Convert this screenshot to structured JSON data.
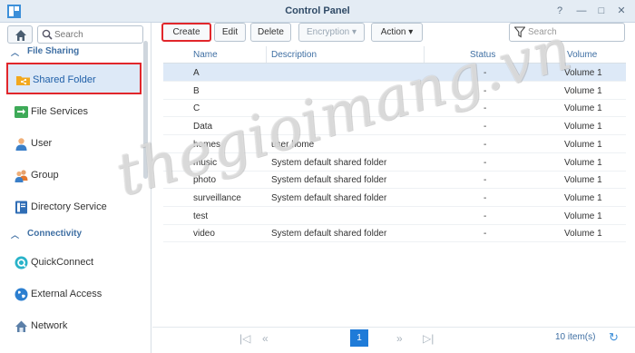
{
  "window": {
    "title": "Control Panel",
    "help": "?",
    "minimize": "—",
    "maximize": "□",
    "close": "✕"
  },
  "sidebar": {
    "search_placeholder": "Search",
    "sections": [
      {
        "label": "File Sharing"
      },
      {
        "label": "Connectivity"
      }
    ],
    "items": [
      {
        "label": "Shared Folder",
        "icon": "shared-folder-icon"
      },
      {
        "label": "File Services",
        "icon": "file-services-icon"
      },
      {
        "label": "User",
        "icon": "user-icon"
      },
      {
        "label": "Group",
        "icon": "group-icon"
      },
      {
        "label": "Directory Service",
        "icon": "directory-service-icon"
      },
      {
        "label": "QuickConnect",
        "icon": "quickconnect-icon"
      },
      {
        "label": "External Access",
        "icon": "globe-icon"
      },
      {
        "label": "Network",
        "icon": "network-icon"
      }
    ]
  },
  "toolbar": {
    "create": "Create",
    "edit": "Edit",
    "delete": "Delete",
    "encryption": "Encryption ▾",
    "action": "Action ▾",
    "filter_placeholder": "Search"
  },
  "table": {
    "headers": {
      "name": "Name",
      "description": "Description",
      "status": "Status",
      "volume": "Volume"
    },
    "rows": [
      {
        "name": "A",
        "description": "",
        "status": "-",
        "volume": "Volume 1"
      },
      {
        "name": "B",
        "description": "",
        "status": "-",
        "volume": "Volume 1"
      },
      {
        "name": "C",
        "description": "",
        "status": "-",
        "volume": "Volume 1"
      },
      {
        "name": "Data",
        "description": "",
        "status": "-",
        "volume": "Volume 1"
      },
      {
        "name": "homes",
        "description": "user home",
        "status": "-",
        "volume": "Volume 1"
      },
      {
        "name": "music",
        "description": "System default shared folder",
        "status": "-",
        "volume": "Volume 1"
      },
      {
        "name": "photo",
        "description": "System default shared folder",
        "status": "-",
        "volume": "Volume 1"
      },
      {
        "name": "surveillance",
        "description": "System default shared folder",
        "status": "-",
        "volume": "Volume 1"
      },
      {
        "name": "test",
        "description": "",
        "status": "-",
        "volume": "Volume 1"
      },
      {
        "name": "video",
        "description": "System default shared folder",
        "status": "-",
        "volume": "Volume 1"
      }
    ]
  },
  "pager": {
    "first": "|◁",
    "prev": "«",
    "current": "1",
    "next": "»",
    "last": "▷|",
    "count": "10 item(s)"
  },
  "watermark": "thegioimang.vn",
  "colors": {
    "accent": "#1f7bd8",
    "highlight_box": "#e1262b",
    "section": "#3f6fa3",
    "selected_row": "#dde9f7"
  }
}
